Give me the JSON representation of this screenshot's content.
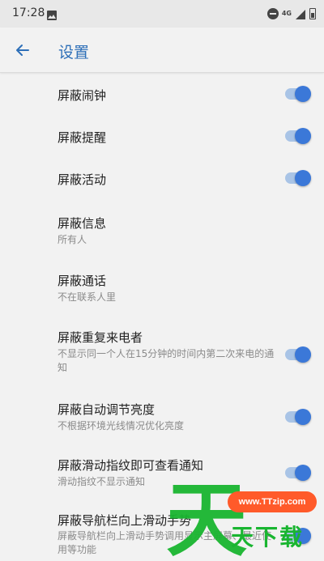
{
  "status_bar": {
    "time": "17:28",
    "network": "4G",
    "icons": [
      "image-icon",
      "do-not-disturb-icon",
      "signal-icon",
      "battery-icon"
    ]
  },
  "app_bar": {
    "title": "设置",
    "accent": "#2d6fb8"
  },
  "settings": [
    {
      "title": "屏蔽闹钟",
      "subtitle": "",
      "toggle": true
    },
    {
      "title": "屏蔽提醒",
      "subtitle": "",
      "toggle": true
    },
    {
      "title": "屏蔽活动",
      "subtitle": "",
      "toggle": true
    },
    {
      "title": "屏蔽信息",
      "subtitle": "所有人",
      "toggle": false
    },
    {
      "title": "屏蔽通话",
      "subtitle": "不在联系人里",
      "toggle": false
    },
    {
      "title": "屏蔽重复来电者",
      "subtitle": "不显示同一个人在15分钟的时间内第二次来电的通知",
      "toggle": true
    },
    {
      "title": "屏蔽自动调节亮度",
      "subtitle": "不根据环境光线情况优化亮度",
      "toggle": true
    },
    {
      "title": "屏蔽滑动指纹即可查看通知",
      "subtitle": "滑动指纹不显示通知",
      "toggle": true
    },
    {
      "title": "屏蔽导航栏向上滑动手势",
      "subtitle": "屏蔽导航栏向上滑动手势调用显示主屏幕、最近使用等功能",
      "toggle": true
    }
  ],
  "toggle_colors": {
    "track": "#a9c4e6",
    "thumb": "#3b78d8"
  },
  "watermark": {
    "big": "天",
    "url": "www.TTzip.com",
    "text": "天下载"
  }
}
